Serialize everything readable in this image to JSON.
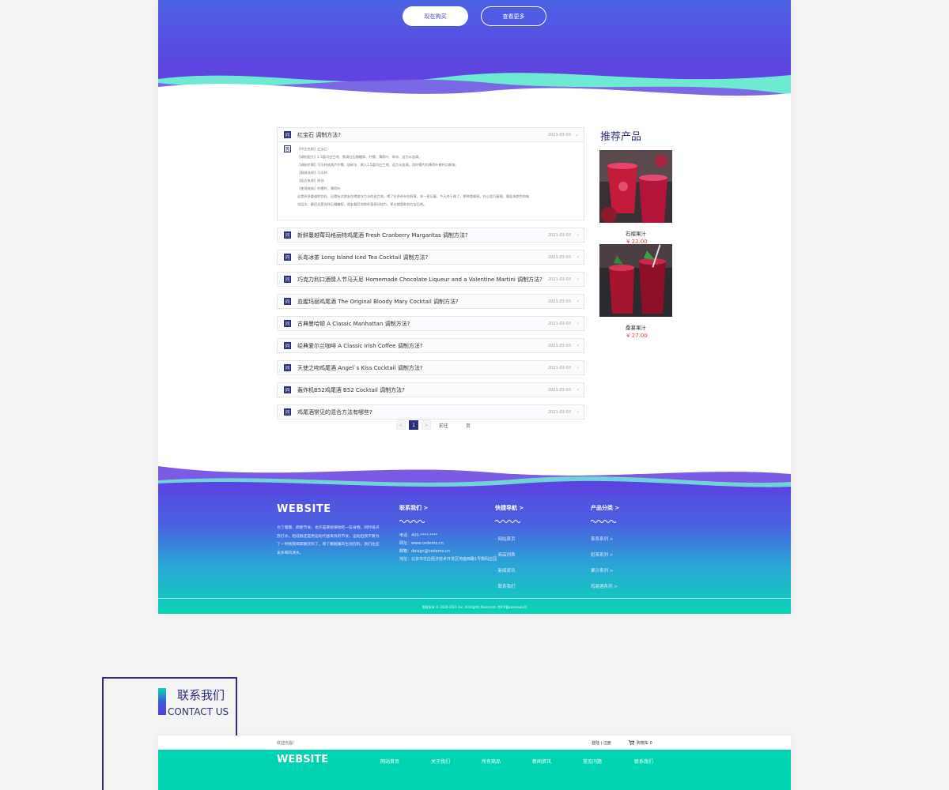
{
  "hero": {
    "buy_label": "现在购买",
    "more_label": "查看更多"
  },
  "faq": {
    "items": [
      {
        "q": "红宝石 调制方法?",
        "date": "2021-03-03",
        "arrow": "⌄",
        "expanded": true,
        "answer": [
          "【中文名称】红宝石",
          "【调制配方】1.5盎司白兰地、数滴红石榴糖浆、柠檬、薄荷叶、碎冰、适力水加满。",
          "【调制步骤】可乐杯放两片柠檬、加碎冰、倒入1.5盎司白兰地，适力水加满，用柠檬片和薄荷叶做杯口装饰。",
          "【载具选择】可乐杯",
          "【配方来源】原创",
          "【使用装饰】柠檬片、薄荷叶",
          "这是杯多重道的饮料，记得有次朋友在喝加冰力水的白兰地，喝了好多杯有些醉意，却一直记着，今天终于做了，那种滑顺感，在心里打着圈，看起来颜色和味",
          "觉层次，最后还是选择石榴糖浆，朋友看后惊那杯喜感动加力，那么就是取名红宝石吧。"
        ]
      },
      {
        "q": "新鲜蔓越莓玛格丽特鸡尾酒 Fresh Cranberry Margaritas 调制方法?",
        "date": "2021-03-03",
        "arrow": "‹"
      },
      {
        "q": "长岛冰茶 Long Island Iced Tea Cocktail 调制方法?",
        "date": "2021-03-03",
        "arrow": "‹"
      },
      {
        "q": "巧克力利口酒情人节马天尼 Homemade Chocolate Liqueur and a Valentine Martini 调制方法?",
        "date": "2021-03-03",
        "arrow": "‹"
      },
      {
        "q": "血腥玛丽鸡尾酒 The Original Bloody Mary Cocktail 调制方法?",
        "date": "2021-03-03",
        "arrow": "‹"
      },
      {
        "q": "古典曼哈顿 A Classic Manhattan 调制方法?",
        "date": "2021-03-03",
        "arrow": "‹"
      },
      {
        "q": "经典爱尔兰咖啡 A Classic Irish Coffee 调制方法?",
        "date": "2021-03-03",
        "arrow": "‹"
      },
      {
        "q": "天使之吻鸡尾酒 Angel`s Kiss Cocktail 调制方法?",
        "date": "2021-03-03",
        "arrow": "‹"
      },
      {
        "q": "轰炸机B52鸡尾酒 B52 Cocktail 调制方法?",
        "date": "2021-03-03",
        "arrow": "‹"
      },
      {
        "q": "鸡尾酒常见的混合方法有哪些?",
        "date": "2021-03-03",
        "arrow": "‹"
      }
    ],
    "q_icon": "问",
    "a_icon": "答"
  },
  "pagination": {
    "prev": "<",
    "current": "1",
    "next": ">",
    "goto_label": "前往",
    "page_suffix": "页"
  },
  "recommend": {
    "title": "推荐产品",
    "products": [
      {
        "name": "石榴果汁",
        "price": "¥ 22.00"
      },
      {
        "name": "桑葚果汁",
        "price": "¥ 27.00"
      }
    ]
  },
  "footer": {
    "logo": "WEBSITE",
    "desc": "为了健康、即使节食、也许是要规律地吃一些食物。同时培点苏打水，组成群还是用运动代替来找的节食，运动后我不要为了一时畅爽喝碳酸饮料了，除了糖越属的生动饮料，我们也应该多喝的清水。",
    "contact_title": "联系我们 >",
    "contact_lines": [
      "电话：400-****-****",
      "网址：www.cedemo.cn",
      "邮箱：design@cedemo.cn",
      "地址：北京市亦庄经济技术开发区地盛西路1号数码庄园"
    ],
    "nav_title": "快捷导航 >",
    "nav_links": [
      "· 网站首页",
      "· 商品列表",
      "· 新闻资讯",
      "· 联系我们"
    ],
    "cat_title": "产品分类 >",
    "cat_links": [
      "茶系系列 >",
      "奶茶系列 >",
      "果汁系列 >",
      "鸡尾酒系列 >"
    ],
    "copyright": "版权所有 © 2020-2021 Inc. All Rights Reserved. 京ICP备xxxxxxxx号"
  },
  "contact_section": {
    "title_cn": "联系我们",
    "title_en": "CONTACT US"
  },
  "page2": {
    "welcome": "欢迎光临!",
    "login": "登陆 | 注册",
    "cart": "购物车  0",
    "logo": "WEBSITE",
    "menu": [
      "网站首页",
      "关于我们",
      "所有商品",
      "新闻资讯",
      "常见问题",
      "联系我们"
    ]
  },
  "colors": {
    "brand_navy": "#2d2f7a",
    "hero_purple": "#5b47e0",
    "teal": "#00d3b1",
    "price_red": "#e63b3b"
  }
}
